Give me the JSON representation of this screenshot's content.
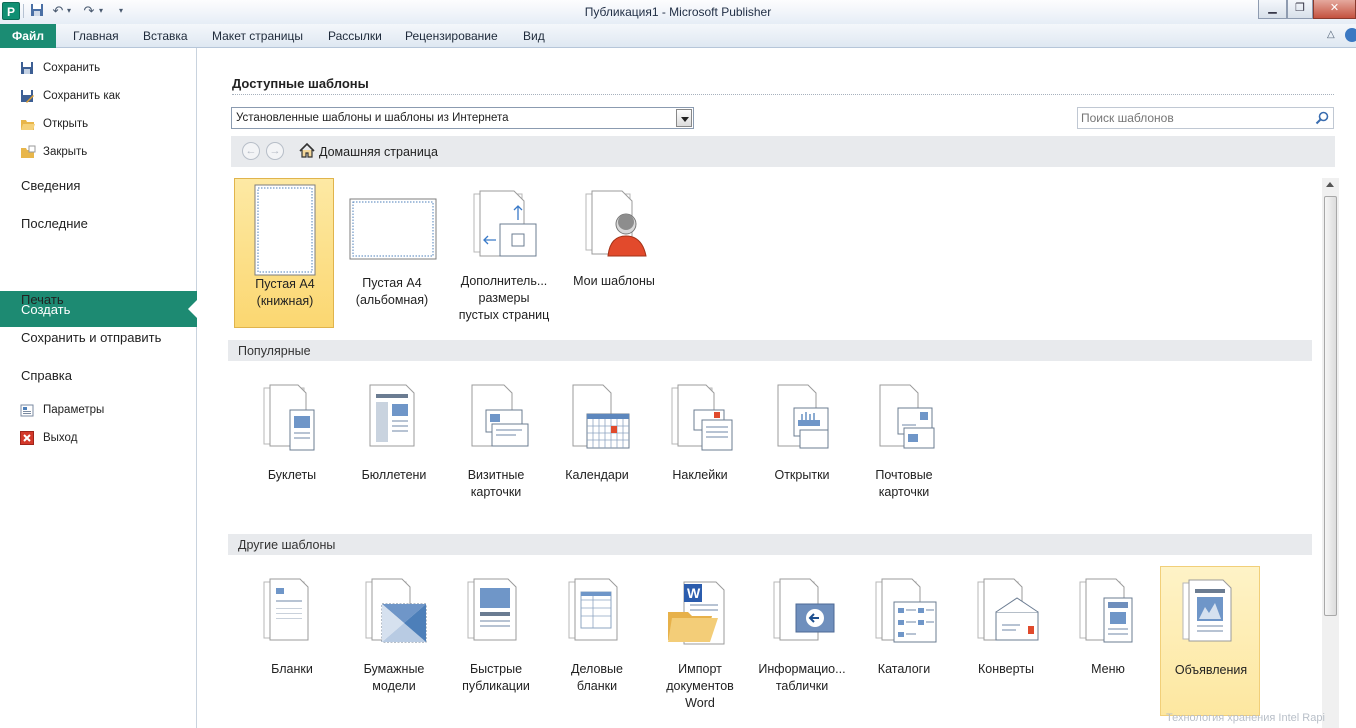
{
  "window": {
    "title": "Публикация1  -  Microsoft Publisher",
    "app_icon_letter": "P"
  },
  "ribbon": {
    "file_tab": "Файл",
    "tabs": [
      "Главная",
      "Вставка",
      "Макет страницы",
      "Рассылки",
      "Рецензирование",
      "Вид"
    ]
  },
  "nav": {
    "save": "Сохранить",
    "save_as": "Сохранить как",
    "open": "Открыть",
    "close": "Закрыть",
    "info": "Сведения",
    "recent": "Последние",
    "new": "Создать",
    "print": "Печать",
    "save_send": "Сохранить и отправить",
    "help": "Справка",
    "options": "Параметры",
    "exit": "Выход"
  },
  "main": {
    "heading": "Доступные шаблоны",
    "source_select": "Установленные шаблоны и шаблоны из Интернета",
    "search_placeholder": "Поиск шаблонов",
    "home_link": "Домашняя страница",
    "top_tiles": [
      {
        "line1": "Пустая А4",
        "line2": "(книжная)"
      },
      {
        "line1": "Пустая А4",
        "line2": "(альбомная)"
      },
      {
        "line1": "Дополнитель...",
        "line2": "размеры",
        "line3": "пустых страниц"
      },
      {
        "line1": "Мои шаблоны"
      }
    ],
    "popular_header": "Популярные",
    "popular": [
      {
        "line1": "Буклеты"
      },
      {
        "line1": "Бюллетени"
      },
      {
        "line1": "Визитные",
        "line2": "карточки"
      },
      {
        "line1": "Календари"
      },
      {
        "line1": "Наклейки"
      },
      {
        "line1": "Открытки"
      },
      {
        "line1": "Почтовые",
        "line2": "карточки"
      }
    ],
    "other_header": "Другие шаблоны",
    "other": [
      {
        "line1": "Бланки"
      },
      {
        "line1": "Бумажные",
        "line2": "модели"
      },
      {
        "line1": "Быстрые",
        "line2": "публикации"
      },
      {
        "line1": "Деловые",
        "line2": "бланки"
      },
      {
        "line1": "Импорт",
        "line2": "документов",
        "line3": "Word"
      },
      {
        "line1": "Информацио...",
        "line2": "таблички"
      },
      {
        "line1": "Каталоги"
      },
      {
        "line1": "Конверты"
      },
      {
        "line1": "Меню"
      },
      {
        "line1": "Объявления"
      }
    ]
  },
  "watermark": "Технология хранения Intel Rapi",
  "colors": {
    "file_tab": "#1b8c73",
    "active_nav": "#1d8a72",
    "selected_tile": "#fbd771",
    "icon_blue": "#4d7fb9"
  }
}
